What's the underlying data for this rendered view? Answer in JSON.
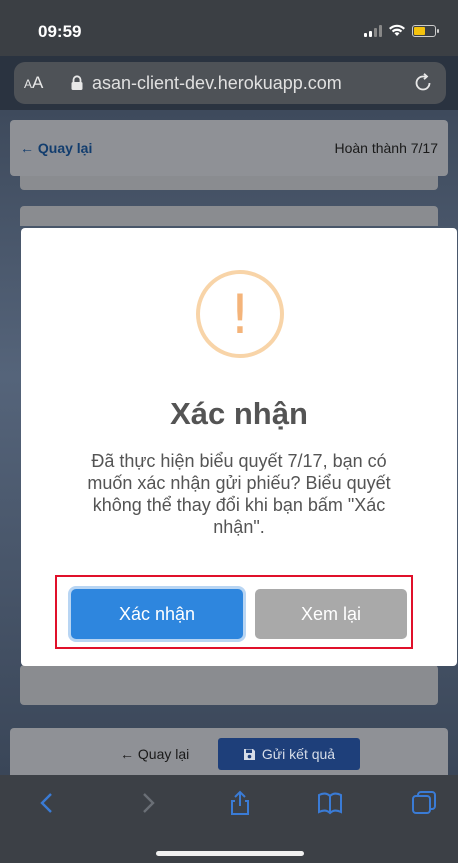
{
  "status_bar": {
    "time": "09:59"
  },
  "browser": {
    "text_size_label": "AA",
    "url": "asan-client-dev.herokuapp.com"
  },
  "page": {
    "back_label": "← Quay lại",
    "progress_label": "Hoàn thành 7/17",
    "bottom_back_label": "← Quay lại",
    "submit_label": "Gửi kết quả"
  },
  "dialog": {
    "icon": "warning-icon",
    "title": "Xác nhận",
    "message": "Đã thực hiện biểu quyết 7/17, bạn có muốn xác nhận gửi phiếu? Biểu quyết không thể thay đổi khi bạn bấm \"Xác nhận\".",
    "confirm_label": "Xác nhận",
    "review_label": "Xem lại"
  },
  "colors": {
    "confirm": "#2e86de",
    "review": "#a9a9a9",
    "highlight_frame": "#e0102a",
    "warning": "#f4b47a"
  }
}
